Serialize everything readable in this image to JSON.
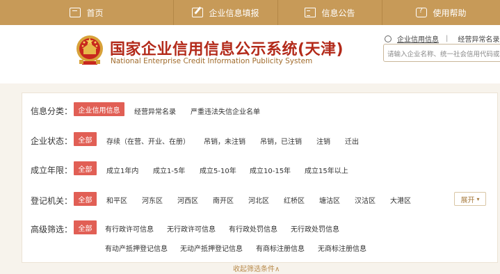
{
  "nav": {
    "items": [
      {
        "label": "首页",
        "icon": "home-icon"
      },
      {
        "label": "企业信息填报",
        "icon": "edit-icon"
      },
      {
        "label": "信息公告",
        "icon": "document-icon"
      },
      {
        "label": "使用帮助",
        "icon": "help-icon"
      }
    ]
  },
  "header": {
    "title_cn": "国家企业信用信息公示系统(天津)",
    "title_en": "National Enterprise Credit Information Publicity System"
  },
  "search": {
    "tab_active": "企业信用信息",
    "tab_other": "经营异常名录",
    "placeholder": "请输入企业名称、统一社会信用代码或"
  },
  "filters": {
    "category": {
      "label": "信息分类：",
      "active": "企业信用信息",
      "options": [
        "经营异常名录",
        "严重违法失信企业名单"
      ]
    },
    "status": {
      "label": "企业状态：",
      "active": "全部",
      "options": [
        "存续（在营、开业、在册）",
        "吊销，未注销",
        "吊销，已注销",
        "注销",
        "迁出"
      ]
    },
    "years": {
      "label": "成立年限：",
      "active": "全部",
      "options": [
        "成立1年内",
        "成立1-5年",
        "成立5-10年",
        "成立10-15年",
        "成立15年以上"
      ]
    },
    "authority": {
      "label": "登记机关：",
      "active": "全部",
      "options": [
        "和平区",
        "河东区",
        "河西区",
        "南开区",
        "河北区",
        "红桥区",
        "塘沽区",
        "汉沽区",
        "大港区"
      ],
      "expand_label": "展开"
    },
    "advanced": {
      "label": "高级筛选：",
      "active": "全部",
      "options_row1": [
        "有行政许可信息",
        "无行政许可信息",
        "有行政处罚信息",
        "无行政处罚信息"
      ],
      "options_row2": [
        "有动产抵押登记信息",
        "无动产抵押登记信息",
        "有商标注册信息",
        "无商标注册信息"
      ]
    },
    "collapse_label": "收起筛选条件∧"
  },
  "colors": {
    "nav_bg": "#c79a58",
    "accent_red": "#e15f55",
    "title_red": "#b32a1a"
  }
}
